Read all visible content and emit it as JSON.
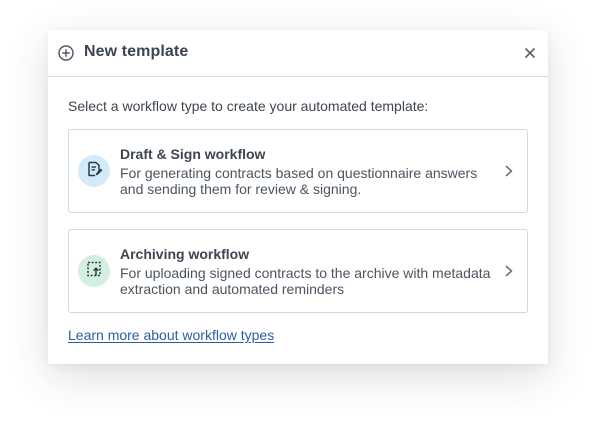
{
  "dialog": {
    "title": "New template",
    "header_icon": "plus-circle-icon",
    "close_icon": "close-icon",
    "prompt": "Select a workflow type to create your automated template:",
    "options": [
      {
        "icon": "document-sign-icon",
        "icon_bg": "#d3eaf8",
        "title": "Draft & Sign workflow",
        "description": "For generating contracts based on questionnaire answers and sending them for review & signing."
      },
      {
        "icon": "archive-upload-icon",
        "icon_bg": "#d2efdf",
        "title": "Archiving workflow",
        "description": "For uploading signed contracts to the archive with metadata extraction and automated reminders"
      }
    ],
    "learn_more": "Learn more about workflow types"
  },
  "colors": {
    "text_primary": "#3d4650",
    "link": "#2a5ea7",
    "border": "#d3d8de"
  }
}
